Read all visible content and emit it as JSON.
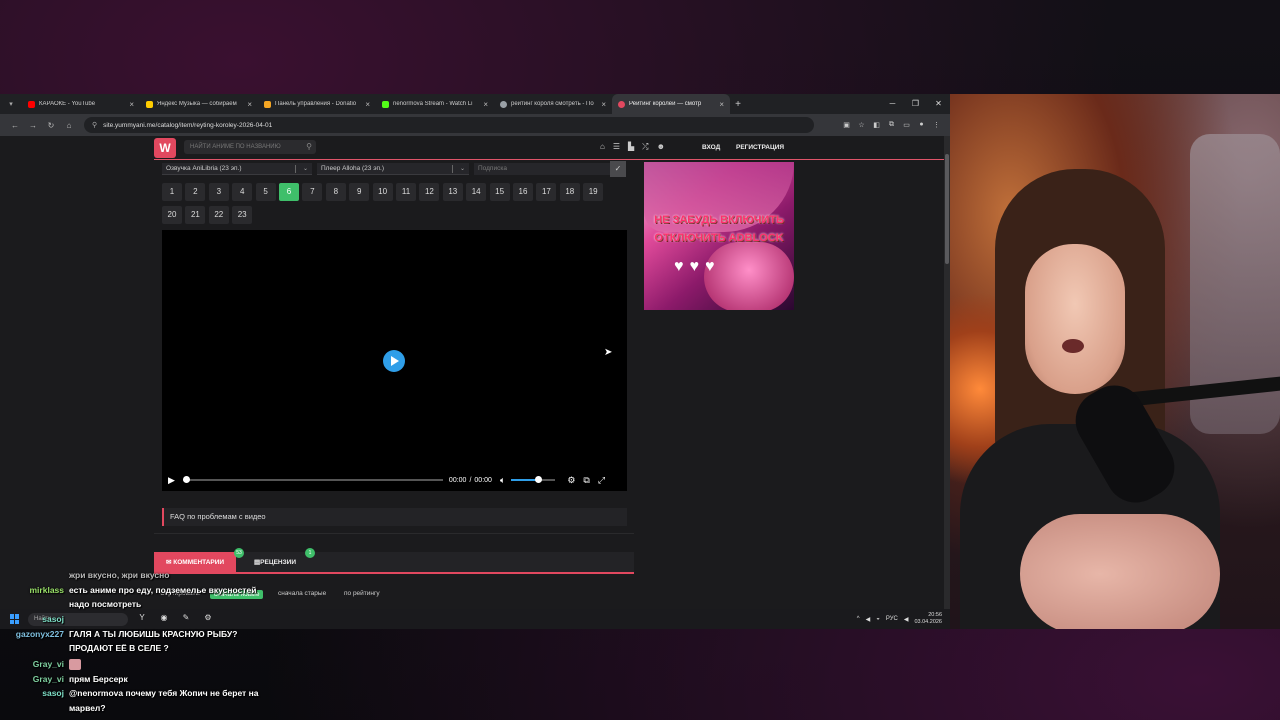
{
  "browser": {
    "tabs": [
      {
        "title": "КАРАОКЕ - YouTube",
        "color": "#ff0000"
      },
      {
        "title": "Яндекс Музыка — собираем",
        "color": "#ffcc00"
      },
      {
        "title": "Панель управления - Donatio",
        "color": "#f5a623"
      },
      {
        "title": "nenormova Stream - Watch Li",
        "color": "#53fc18"
      },
      {
        "title": "рейтинг короля смотреть - По",
        "color": "#9aa0a6"
      },
      {
        "title": "Рейтинг королей — смотр",
        "color": "#e2485f"
      }
    ],
    "new_tab": "+",
    "url": "site.yummyani.me/catalog/item/reyting-koroley-2026-04-01"
  },
  "site": {
    "logo": "W",
    "search_placeholder": "НАЙТИ АНИМЕ ПО НАЗВАНИЮ",
    "login": "ВХОД",
    "register": "РЕГИСТРАЦИЯ",
    "voice_select": "Озвучка AniLibria (23 эп.)",
    "player_select": "Плеер Alloha (23 эп.)",
    "subtitle_placeholder": "Подписка",
    "episodes": [
      "1",
      "2",
      "3",
      "4",
      "5",
      "6",
      "7",
      "8",
      "9",
      "10",
      "11",
      "12",
      "13",
      "14",
      "15",
      "16",
      "17",
      "18",
      "19",
      "20",
      "21",
      "22",
      "23"
    ],
    "active_episode": "6",
    "player": {
      "current": "00:00",
      "sep": "/",
      "duration": "00:00",
      "progress": 0,
      "volume": 0.6
    },
    "faq": "FAQ по проблемам с видео",
    "comments_tab": "КОММЕНТАРИИ",
    "comments_count": "53",
    "reviews_tab": "РЕЦЕНЗИИ",
    "reviews_count": "1",
    "sort_label": "Сортировать:",
    "sort_options": [
      "сначала новые",
      "сначала старые",
      "по рейтингу"
    ],
    "poster_text_1": "НЕ ЗАБУДЬ ВКЛЮЧИТЬ",
    "poster_text_2": "ОТКЛЮЧИТЬ ADBLOCK",
    "poster_hearts": "♥♥♥"
  },
  "taskbar": {
    "search": "Найти",
    "lang": "РУС",
    "time": "20:56",
    "date": "03.04.2026"
  },
  "chat": [
    {
      "nick": "",
      "text": "жри вкусно, жри вкусно",
      "color": "#8a7fd0"
    },
    {
      "nick": "mirklass",
      "text": "есть аниме про еду, подземелье вкусностей",
      "color": "#9be36a"
    },
    {
      "nick": "",
      "text": "надо посмотреть",
      "color": "#9be36a"
    },
    {
      "nick": "sasoj",
      "text": "",
      "color": "#7fe0c8"
    },
    {
      "nick": "gazonyx227",
      "text": "ГАЛЯ А ТЫ ЛЮБИШЬ КРАСНУЮ РЫБУ?",
      "color": "#7fc0e0"
    },
    {
      "nick": "",
      "text": "ПРОДАЮТ ЕЁ В СЕЛЕ ?",
      "color": "#7fc0e0"
    },
    {
      "nick": "Gray_vi",
      "text": "",
      "color": "#7fd0a0"
    },
    {
      "nick": "Gray_vi",
      "text": "прям Берсерк",
      "color": "#7fd0a0"
    },
    {
      "nick": "sasoj",
      "text": "@nenormova почему тебя Жопич не берет на",
      "color": "#7fe0c8"
    },
    {
      "nick": "",
      "text": "марвел?",
      "color": "#7fe0c8"
    }
  ]
}
